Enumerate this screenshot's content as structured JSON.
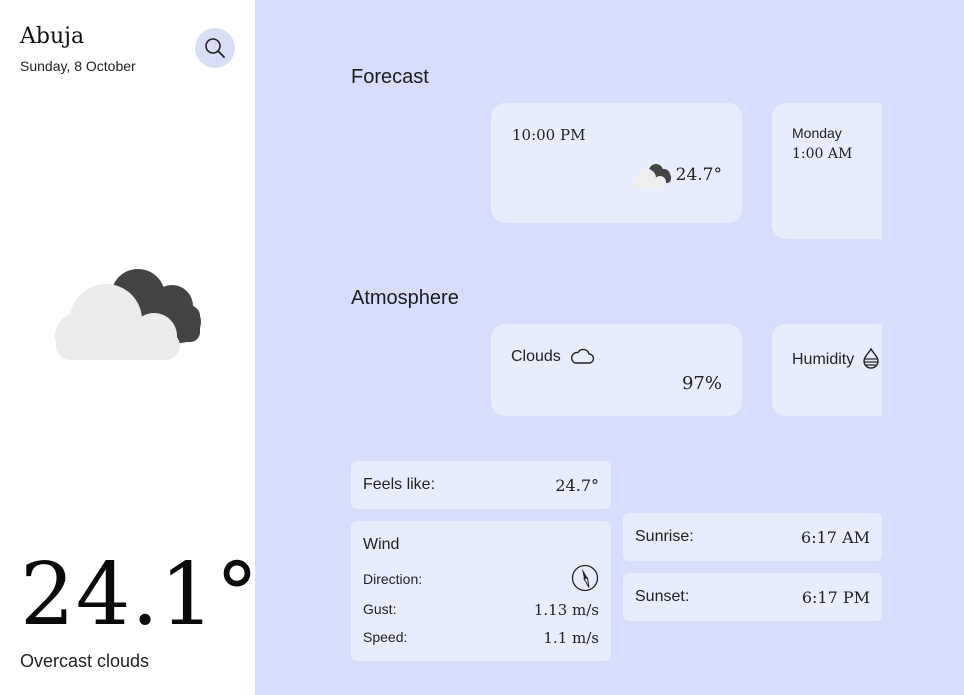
{
  "sidebar": {
    "city": "Abuja",
    "date": "Sunday, 8 October",
    "temperature": "24.1°",
    "condition": "Overcast clouds",
    "weather_icon": "overcast-clouds-icon"
  },
  "forecast": {
    "title": "Forecast",
    "items": [
      {
        "time": "10:00 PM",
        "temp": "24.7°",
        "icon": "overcast-clouds-icon"
      },
      {
        "day": "Monday",
        "time": "1:00 AM"
      }
    ]
  },
  "atmosphere": {
    "title": "Atmosphere",
    "items": [
      {
        "label": "Clouds",
        "value": "97%",
        "icon": "cloud-outline-icon"
      },
      {
        "label": "Humidity",
        "icon": "water-drop-icon"
      }
    ]
  },
  "details": {
    "feels_like": {
      "label": "Feels like:",
      "value": "24.7°"
    },
    "wind": {
      "title": "Wind",
      "direction_label": "Direction:",
      "gust_label": "Gust:",
      "gust_value": "1.13 m/s",
      "speed_label": "Speed:",
      "speed_value": "1.1 m/s",
      "direction_icon": "compass-icon"
    },
    "sunrise": {
      "label": "Sunrise:",
      "value": "6:17 AM"
    },
    "sunset": {
      "label": "Sunset:",
      "value": "6:17 PM"
    }
  },
  "colors": {
    "main_bg": "#d7defd",
    "card_bg": "#e8edfd",
    "search_bg": "#d9def7"
  }
}
